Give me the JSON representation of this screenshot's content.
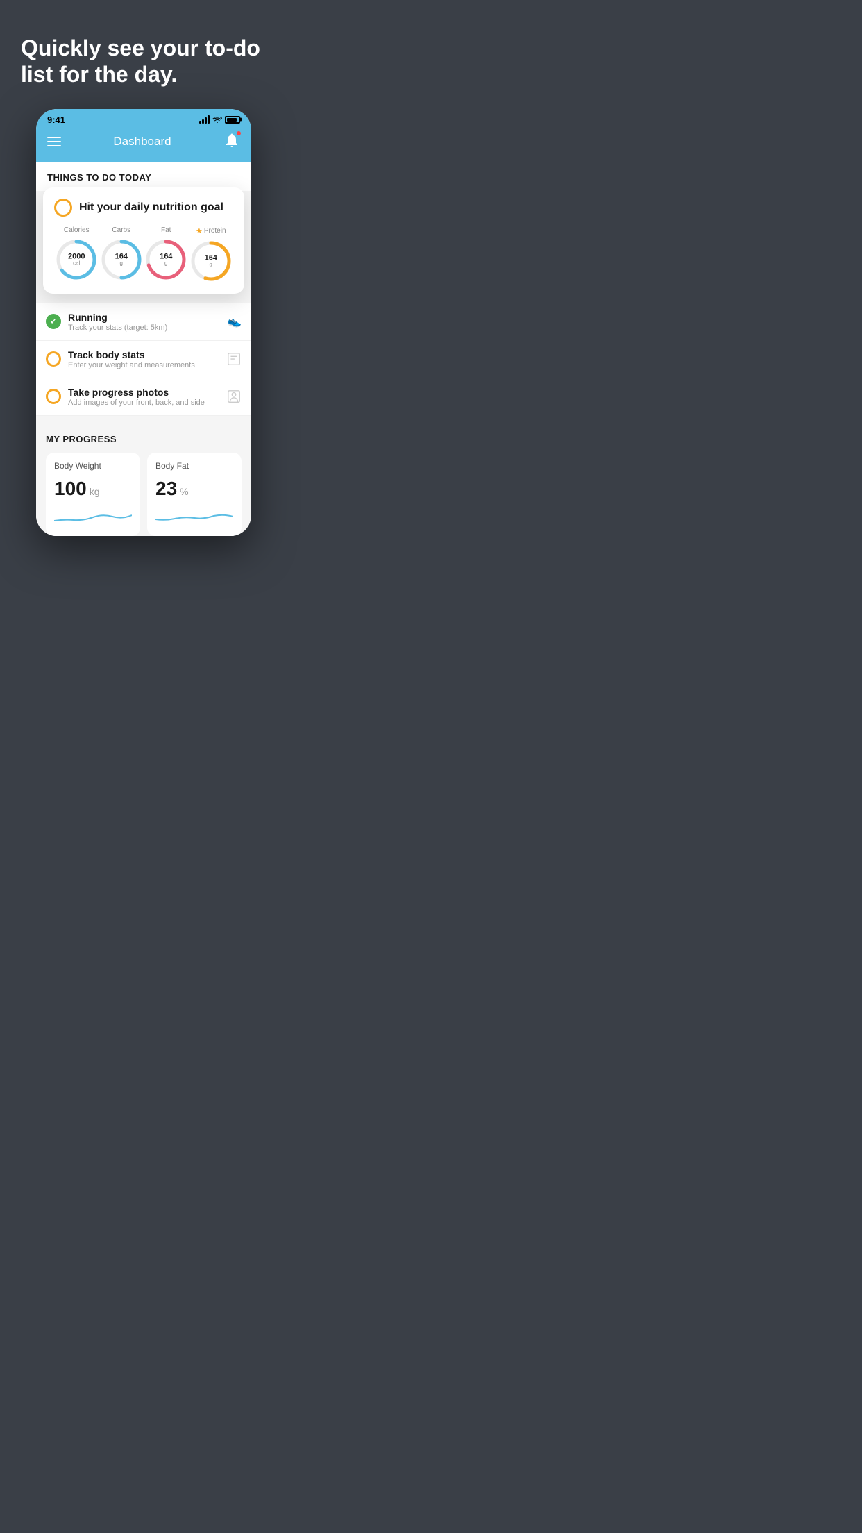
{
  "hero": {
    "title": "Quickly see your to-do list for the day."
  },
  "statusBar": {
    "time": "9:41"
  },
  "appBar": {
    "title": "Dashboard"
  },
  "thingsToDo": {
    "sectionTitle": "THINGS TO DO TODAY"
  },
  "nutritionCard": {
    "title": "Hit your daily nutrition goal",
    "items": [
      {
        "label": "Calories",
        "value": "2000",
        "unit": "cal",
        "color": "#5bbde4",
        "progress": 0.65
      },
      {
        "label": "Carbs",
        "value": "164",
        "unit": "g",
        "color": "#5bbde4",
        "progress": 0.5
      },
      {
        "label": "Fat",
        "value": "164",
        "unit": "g",
        "color": "#e8607a",
        "progress": 0.7
      },
      {
        "label": "Protein",
        "value": "164",
        "unit": "g",
        "color": "#f5a623",
        "progress": 0.55,
        "starred": true
      }
    ]
  },
  "todoItems": [
    {
      "title": "Running",
      "subtitle": "Track your stats (target: 5km)",
      "status": "completed",
      "icon": "shoe"
    },
    {
      "title": "Track body stats",
      "subtitle": "Enter your weight and measurements",
      "status": "pending",
      "icon": "scale"
    },
    {
      "title": "Take progress photos",
      "subtitle": "Add images of your front, back, and side",
      "status": "pending",
      "icon": "portrait"
    }
  ],
  "progress": {
    "sectionTitle": "MY PROGRESS",
    "cards": [
      {
        "title": "Body Weight",
        "value": "100",
        "unit": "kg"
      },
      {
        "title": "Body Fat",
        "value": "23",
        "unit": "%"
      }
    ]
  }
}
